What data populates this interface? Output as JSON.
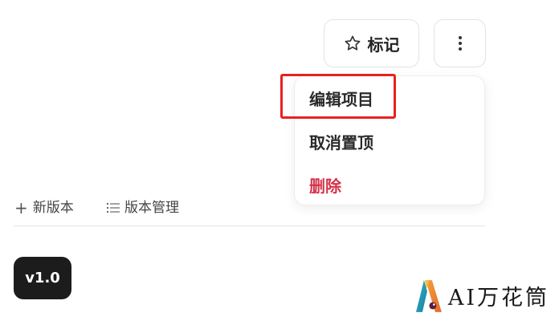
{
  "header": {
    "mark_label": "标记",
    "star_icon": "star-outline-icon",
    "more_icon": "vertical-dots-icon"
  },
  "menu": {
    "items": [
      {
        "label": "编辑项目"
      },
      {
        "label": "取消置顶"
      },
      {
        "label": "删除"
      }
    ],
    "delete_color": "#d5334a",
    "highlight_color": "#e8211f"
  },
  "versions": {
    "new_label": "新版本",
    "manage_label": "版本管理",
    "badge": "v1.0"
  },
  "watermark": {
    "text": "AI万花筒"
  }
}
